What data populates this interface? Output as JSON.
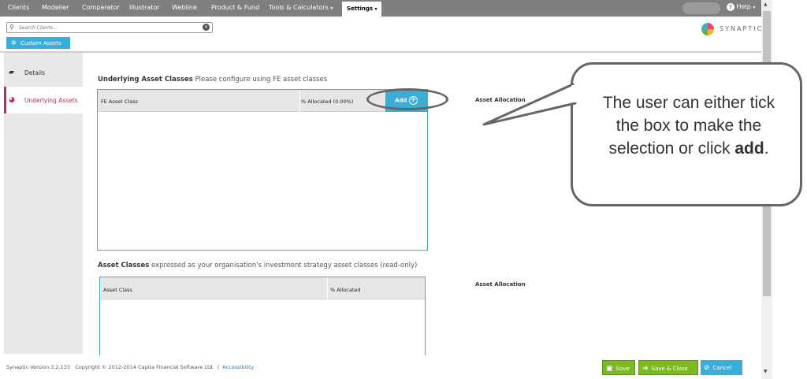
{
  "nav": {
    "items": [
      {
        "label": "Clients"
      },
      {
        "label": "Modeller"
      },
      {
        "label": "Comparator"
      },
      {
        "label": "Illustrator"
      },
      {
        "label": "Webline"
      },
      {
        "label": "Product & Fund"
      },
      {
        "label": "Tools & Calculators",
        "caret": "▾"
      }
    ],
    "active": {
      "label": "Settings",
      "caret": "▾"
    },
    "help": {
      "label": "Help",
      "caret": "▾"
    }
  },
  "search": {
    "placeholder": "Search Clients..."
  },
  "custom_assets_label": "Custom Assets",
  "brand": {
    "name": "SYNAPTIC"
  },
  "sidebar": {
    "items": [
      {
        "label": "Details",
        "icon": "briefcase-icon"
      },
      {
        "label": "Underlying Assets",
        "icon": "pie-chart-icon"
      }
    ]
  },
  "underlying": {
    "title_bold": "Underlying Asset Classes",
    "title_rest": "Please configure using FE asset classes",
    "col_class": "FE Asset Class",
    "col_alloc": "% Allocated (0.00%)",
    "add_label": "Add",
    "alloc_title": "Asset Allocation"
  },
  "assets": {
    "title_bold": "Asset Classes",
    "title_rest": "expressed as your organisation's investment strategy asset classes (read-only)",
    "col_class": "Asset Class",
    "col_alloc": "% Allocated",
    "alloc_title": "Asset Allocation"
  },
  "callout": {
    "text_before": "The user can either tick the box to make the selection or click ",
    "text_bold": "add",
    "text_after": "."
  },
  "footer": {
    "version": "Synaptic Version 3.2.133",
    "copyright": "Copyright © 2012-2014 Capita Financial Software Ltd.",
    "separator": "|",
    "accessibility": "Accessibility"
  },
  "buttons": {
    "save": "Save",
    "save_close": "Save & Close",
    "cancel": "Cancel"
  },
  "colors": {
    "nav_bg": "#7f7f7f",
    "accent_blue": "#3aaed8",
    "sidebar_active": "#c8265b",
    "save_green": "#7cba24"
  }
}
